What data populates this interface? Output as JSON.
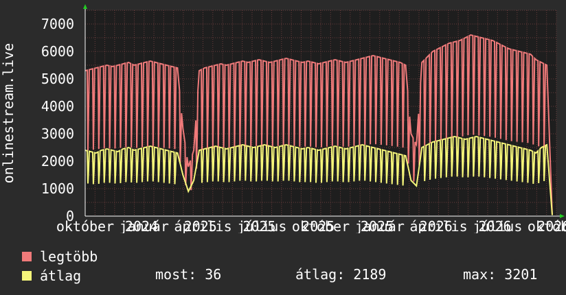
{
  "chart_data": {
    "type": "line",
    "ylabel": "onlinestream.live",
    "ylim": [
      0,
      7500
    ],
    "yticks": [
      0,
      1000,
      2000,
      3000,
      4000,
      5000,
      6000,
      7000
    ],
    "grid": true,
    "x_tick_labels": [
      "október",
      "január",
      "április",
      "július",
      "október",
      "január",
      "április",
      "július",
      "október"
    ],
    "x_tick_years": [
      "2024",
      "2025",
      "2025",
      "2025",
      "2025",
      "2026",
      "2026",
      "2026",
      "2026"
    ],
    "x_range": [
      "2024-10-01",
      "2026-10-01"
    ],
    "series": [
      {
        "name": "legtöbb",
        "color": "#f07a7a",
        "values": [
          5300,
          5350,
          5400,
          5450,
          5500,
          5450,
          5500,
          5550,
          5600,
          5500,
          5550,
          5600,
          5650,
          5600,
          5550,
          5500,
          5450,
          5400,
          3200,
          1800,
          2400,
          5300,
          5400,
          5450,
          5500,
          5550,
          5500,
          5550,
          5600,
          5650,
          5600,
          5650,
          5700,
          5650,
          5600,
          5650,
          5700,
          5750,
          5700,
          5650,
          5600,
          5650,
          5600,
          5550,
          5600,
          5650,
          5700,
          5650,
          5600,
          5650,
          5700,
          5750,
          5800,
          5850,
          5800,
          5750,
          5700,
          5650,
          5600,
          5500,
          3000,
          2600,
          5600,
          5800,
          6000,
          6100,
          6200,
          6300,
          6350,
          6400,
          6500,
          6600,
          6550,
          6500,
          6450,
          6400,
          6300,
          6200,
          6100,
          6050,
          6000,
          5950,
          5900,
          5700,
          5600,
          5500,
          40
        ]
      },
      {
        "name": "átlag",
        "color": "#f5f57a",
        "values": [
          2400,
          2350,
          2300,
          2400,
          2450,
          2400,
          2350,
          2450,
          2500,
          2400,
          2450,
          2500,
          2550,
          2500,
          2450,
          2400,
          2350,
          2300,
          1500,
          900,
          1300,
          2400,
          2450,
          2500,
          2550,
          2500,
          2450,
          2500,
          2550,
          2600,
          2550,
          2500,
          2550,
          2600,
          2550,
          2500,
          2550,
          2600,
          2550,
          2500,
          2450,
          2500,
          2450,
          2400,
          2450,
          2500,
          2550,
          2500,
          2450,
          2500,
          2550,
          2600,
          2550,
          2500,
          2450,
          2400,
          2350,
          2300,
          2250,
          2200,
          1300,
          1100,
          2500,
          2600,
          2700,
          2750,
          2800,
          2850,
          2900,
          2850,
          2800,
          2850,
          2900,
          2850,
          2800,
          2750,
          2700,
          2650,
          2600,
          2550,
          2500,
          2450,
          2400,
          2300,
          2500,
          2600,
          36
        ]
      }
    ]
  },
  "legend": {
    "items": [
      {
        "label": "legtöbb",
        "color": "#f07a7a"
      },
      {
        "label": "átlag",
        "color": "#f5f57a"
      }
    ]
  },
  "stats": {
    "current": "most: 36",
    "average": "átlag: 2189",
    "max": "max: 3201"
  },
  "colors": {
    "background": "#2b2b2b",
    "plot_background": "#1e1e1e",
    "grid": "#6b3c3c",
    "axis": "#ffffff",
    "arrow": "#22cc22"
  }
}
